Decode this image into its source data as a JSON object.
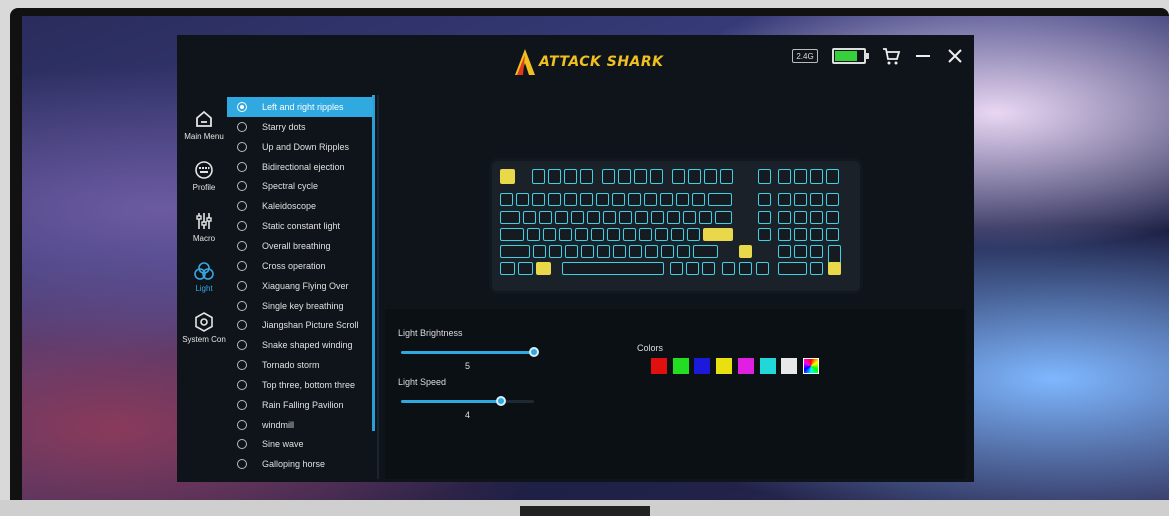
{
  "app": {
    "brand": "ATTACK SHARK",
    "connection_badge": "2.4G",
    "battery_level": 0.8,
    "icons": [
      "cart-icon",
      "minimize-icon",
      "close-icon"
    ]
  },
  "nav": {
    "items": [
      {
        "label": "Main Menu",
        "icon": "home-icon"
      },
      {
        "label": "Profile",
        "icon": "keyboard-icon"
      },
      {
        "label": "Macro",
        "icon": "sliders-icon"
      },
      {
        "label": "Light",
        "icon": "light-icon"
      },
      {
        "label": "System Con",
        "icon": "settings-icon"
      }
    ],
    "active": "Light"
  },
  "effects": {
    "selected": "Left and right ripples",
    "items": [
      "Left and right ripples",
      "Starry dots",
      "Up and Down Ripples",
      "Bidirectional ejection",
      "Spectral cycle",
      "Kaleidoscope",
      "Static constant light",
      "Overall breathing",
      "Cross operation",
      "Xiaguang Flying Over",
      "Single key breathing",
      "Jiangshan Picture Scroll",
      "Snake shaped winding",
      "Tornado storm",
      "Top three, bottom three",
      "Rain Falling Pavilion",
      "windmill",
      "Sine wave",
      "Galloping horse"
    ]
  },
  "controls": {
    "brightness_label": "Light Brightness",
    "brightness_value": "5",
    "brightness_fraction": 1.0,
    "speed_label": "Light Speed",
    "speed_value": "4",
    "speed_fraction": 0.75,
    "colors_label": "Colors",
    "colors": [
      "#e01010",
      "#22dd22",
      "#1a1ad8",
      "#e8e010",
      "#e020e0",
      "#20d8d8",
      "#e8e8e8",
      "rainbow"
    ]
  },
  "keyboard": {
    "edge_color": "#3fd0e4",
    "highlight_color": "#e8d84a"
  }
}
